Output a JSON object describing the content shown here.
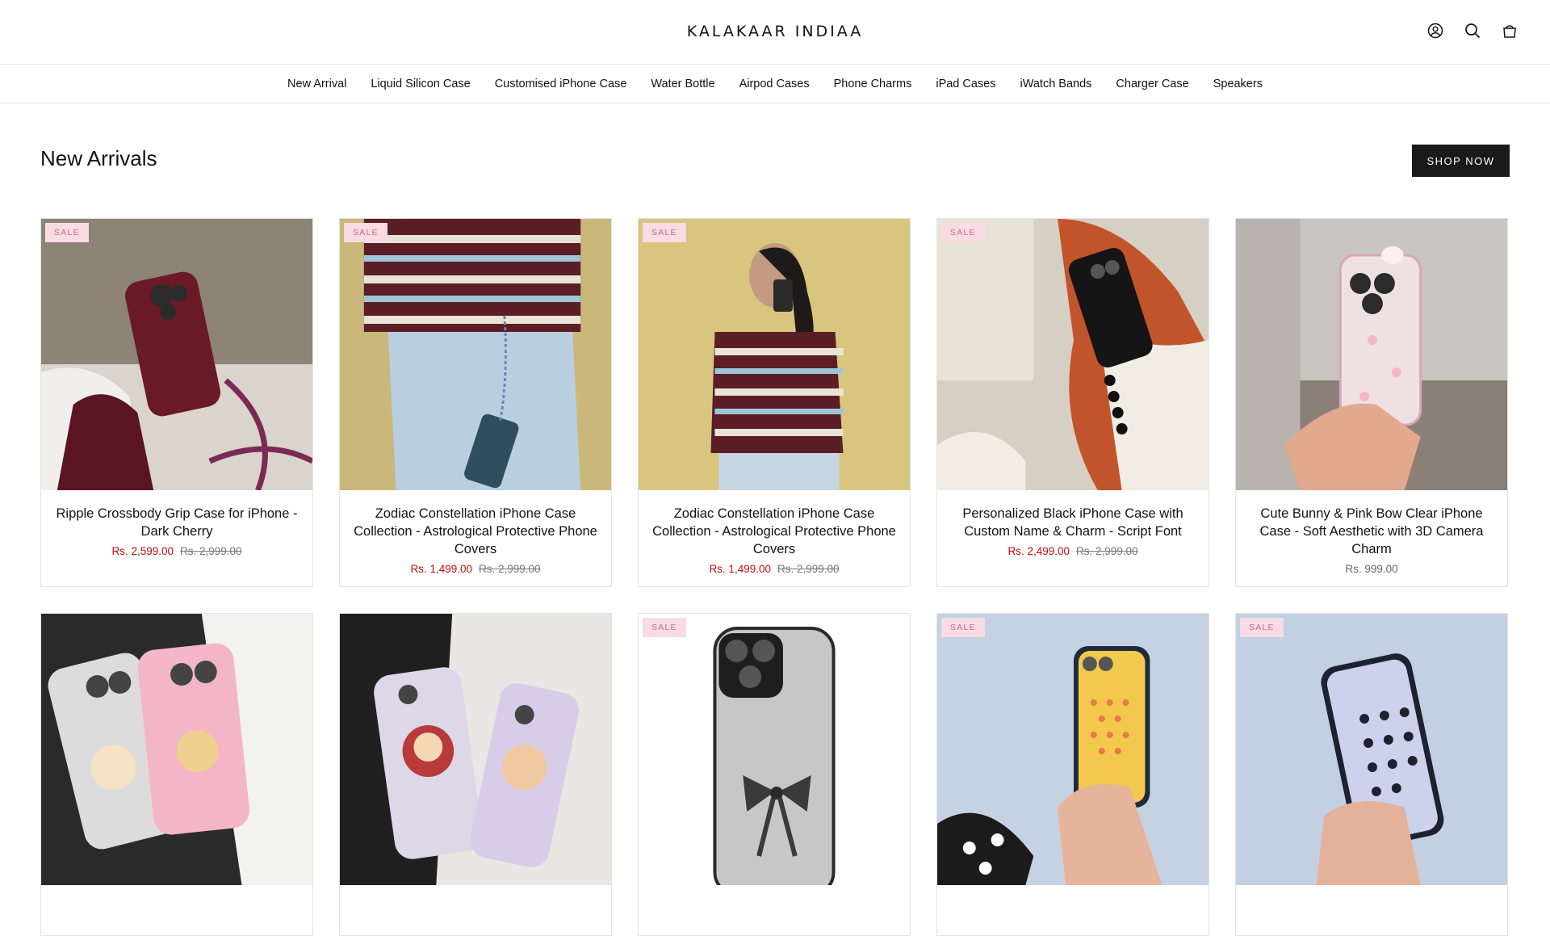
{
  "header": {
    "logo": "KALAKAAR INDIAA",
    "icons": [
      "account-icon",
      "search-icon",
      "cart-icon"
    ]
  },
  "nav": {
    "items": [
      "New Arrival",
      "Liquid Silicon Case",
      "Customised iPhone Case",
      "Water Bottle",
      "Airpod Cases",
      "Phone Charms",
      "iPad Cases",
      "iWatch Bands",
      "Charger Case",
      "Speakers"
    ]
  },
  "section": {
    "title": "New Arrivals",
    "button": "SHOP NOW"
  },
  "products": [
    {
      "badge": "SALE",
      "title": "Ripple Crossbody Grip Case for iPhone - Dark Cherry",
      "sale_price": "Rs. 2,599.00",
      "compare_price": "Rs. 2,999.00"
    },
    {
      "badge": "SALE",
      "title": "Zodiac Constellation iPhone Case Collection - Astrological Protective Phone Covers",
      "sale_price": "Rs. 1,499.00",
      "compare_price": "Rs. 2,999.00"
    },
    {
      "badge": "SALE",
      "title": "Zodiac Constellation iPhone Case Collection - Astrological Protective Phone Covers",
      "sale_price": "Rs. 1,499.00",
      "compare_price": "Rs. 2,999.00"
    },
    {
      "badge": "SALE",
      "title": "Personalized Black iPhone Case with Custom Name & Charm - Script Font",
      "sale_price": "Rs. 2,499.00",
      "compare_price": "Rs. 2,999.00"
    },
    {
      "badge": "",
      "title": "Cute Bunny & Pink Bow Clear iPhone Case - Soft Aesthetic with 3D Camera Charm",
      "price": "Rs. 999.00"
    },
    {
      "badge": ""
    },
    {
      "badge": ""
    },
    {
      "badge": "SALE"
    },
    {
      "badge": "SALE"
    },
    {
      "badge": "SALE"
    }
  ]
}
